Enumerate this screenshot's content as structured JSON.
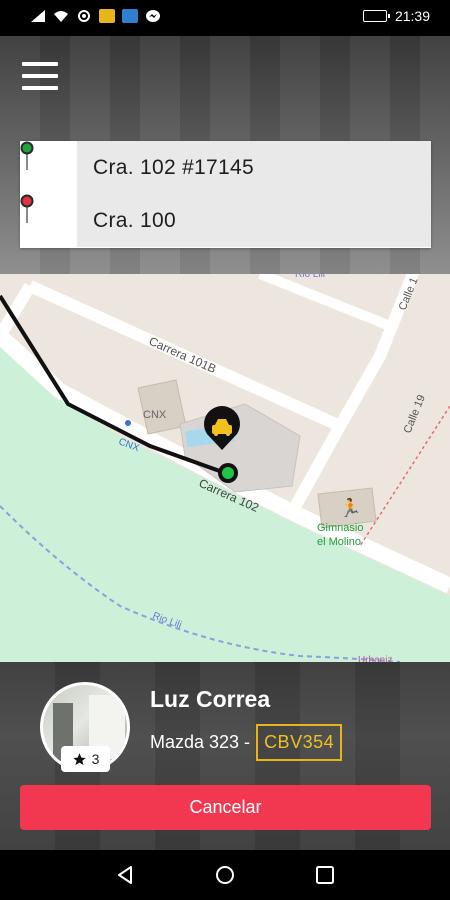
{
  "status_bar": {
    "time": "21:39"
  },
  "menu": {
    "icon": "hamburger-menu-icon"
  },
  "route": {
    "origin": "Cra. 102 #17145",
    "destination": "Cra. 100",
    "origin_pin_color": "#21a23a",
    "destination_pin_color": "#e0333f"
  },
  "map": {
    "labels": {
      "carrera_101b": "Carrera 101B",
      "carrera_102": "Carrera 102",
      "calle_19": "Calle 19",
      "calle_top": "Calle 1",
      "cnx_building": "CNX",
      "cnx_stop": "CNX",
      "gym_line1": "Gimnasio",
      "gym_line2": "el Molino",
      "rio_lili_bottom": "Rio Lili",
      "rio_lili_top": "Rio Lili",
      "urbanizacion": "Urbaniz"
    }
  },
  "driver": {
    "name": "Luz Correa",
    "rating": "3",
    "car": "Mazda 323 -",
    "plate": "CBV354"
  },
  "actions": {
    "cancel": "Cancelar"
  },
  "colors": {
    "cancel": "#f23751",
    "plate": "#f0c023"
  }
}
